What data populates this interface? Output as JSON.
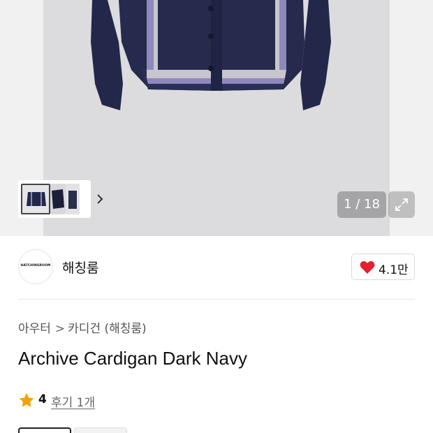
{
  "gallery": {
    "page_counter": "1 / 18",
    "thumbnails": [
      "thumbnail-front",
      "thumbnail-side",
      "thumbnail-detail"
    ],
    "next_icon": "chevron-right-icon",
    "expand_icon": "expand-icon"
  },
  "seller": {
    "logo_text": "HATCHINGROOM",
    "name": "해칭룸",
    "like_count": "4.1만",
    "like_icon": "heart-icon",
    "like_color": "#e5202e"
  },
  "product": {
    "breadcrumb": [
      "아우터",
      "카디건 (해칭룸)"
    ],
    "breadcrumb_separator": ">",
    "title": "Archive Cardigan Dark Navy",
    "rating": "4",
    "rating_icon": "star-icon",
    "rating_color": "#f5a100",
    "reviews_label": "후기 1개"
  },
  "colors": {
    "cardigan": "#23284a",
    "stripe": "#8a82b8"
  }
}
